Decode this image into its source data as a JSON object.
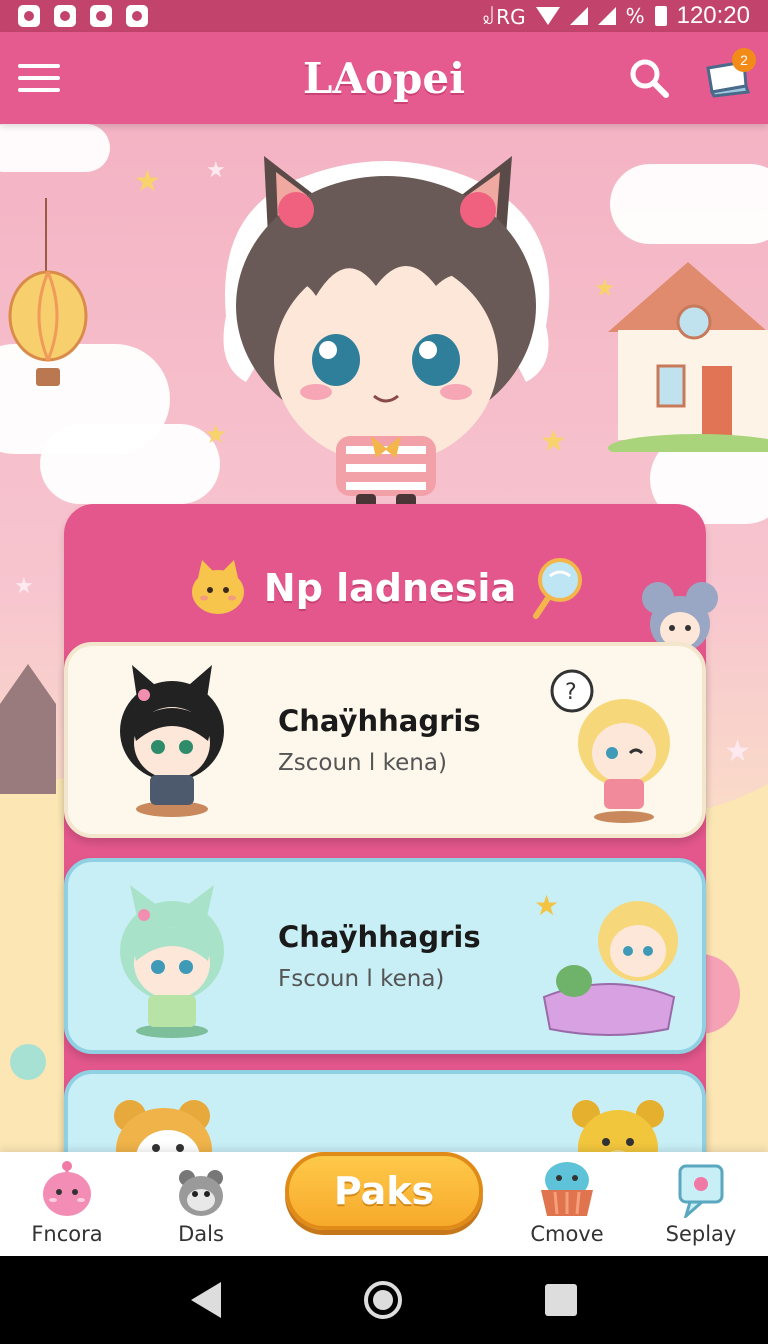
{
  "status_bar": {
    "network": "꒻RG",
    "battery_symbol": "%",
    "time": "120:20"
  },
  "app_bar": {
    "title": "LAopei",
    "cart_badge": "2"
  },
  "section": {
    "title": "Np ladnesia"
  },
  "cards": [
    {
      "title": "Chaÿhhagris",
      "subtitle": "Zscoun l kena)"
    },
    {
      "title": "Chaÿhhagris",
      "subtitle": "Fscoun l kena)"
    }
  ],
  "bottom_nav": {
    "items": [
      {
        "label": "Fncora",
        "icon": "pink-monster-icon"
      },
      {
        "label": "Dals",
        "icon": "grey-cat-icon"
      },
      {
        "label": "Cmove",
        "icon": "cupcake-icon"
      },
      {
        "label": "Seplay",
        "icon": "speech-bubble-icon"
      }
    ],
    "cta_label": "Paks"
  },
  "colors": {
    "app_bar": "#e65b8f",
    "panel": "#e3578c",
    "accent_cta": "#f7aa2b",
    "badge": "#f28b18"
  }
}
